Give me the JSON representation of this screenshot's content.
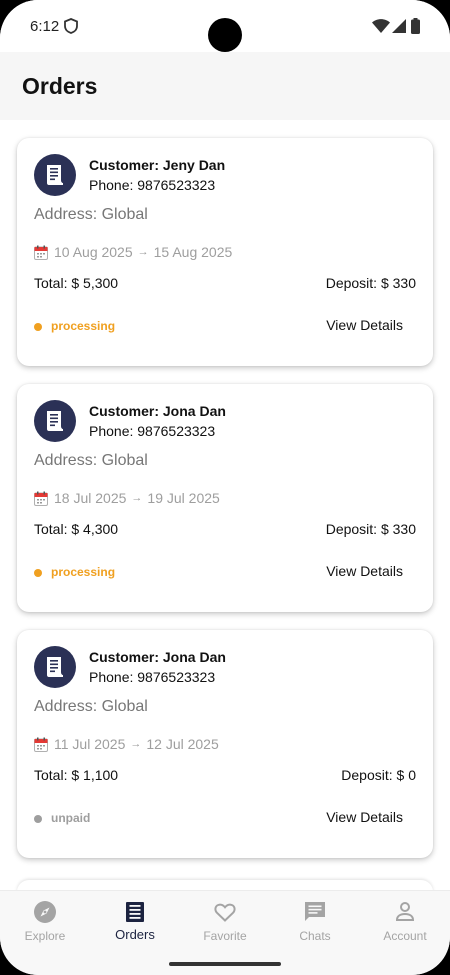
{
  "status_bar": {
    "time": "6:12"
  },
  "app_bar": {
    "title": "Orders"
  },
  "orders": [
    {
      "customer": "Customer: Jeny Dan",
      "phone": "Phone: 9876523323",
      "address": "Address: Global",
      "start_date": "10 Aug 2025",
      "end_date": "15 Aug 2025",
      "total": "Total: $ 5,300",
      "deposit": "Deposit: $ 330",
      "status": "processing",
      "status_color": "#f0a020",
      "action": "View Details"
    },
    {
      "customer": "Customer: Jona Dan",
      "phone": "Phone: 9876523323",
      "address": "Address: Global",
      "start_date": "18 Jul 2025",
      "end_date": "19 Jul 2025",
      "total": "Total: $ 4,300",
      "deposit": "Deposit: $ 330",
      "status": "processing",
      "status_color": "#f0a020",
      "action": "View Details"
    },
    {
      "customer": "Customer: Jona Dan",
      "phone": "Phone: 9876523323",
      "address": "Address: Global",
      "start_date": "11 Jul 2025",
      "end_date": "12 Jul 2025",
      "total": "Total: $ 1,100",
      "deposit": "Deposit: $ 0",
      "status": "unpaid",
      "status_color": "#9e9e9e",
      "action": "View Details"
    }
  ],
  "arrow": "→",
  "bottom_nav": {
    "items": [
      {
        "label": "Explore",
        "icon": "compass-icon"
      },
      {
        "label": "Orders",
        "icon": "receipt-icon",
        "active": true
      },
      {
        "label": "Favorite",
        "icon": "heart-icon"
      },
      {
        "label": "Chats",
        "icon": "chat-icon"
      },
      {
        "label": "Account",
        "icon": "person-icon"
      }
    ]
  },
  "colors": {
    "accent": "#2b3156",
    "active_nav": "#1c2340",
    "inactive_nav": "#a4a4a4"
  }
}
